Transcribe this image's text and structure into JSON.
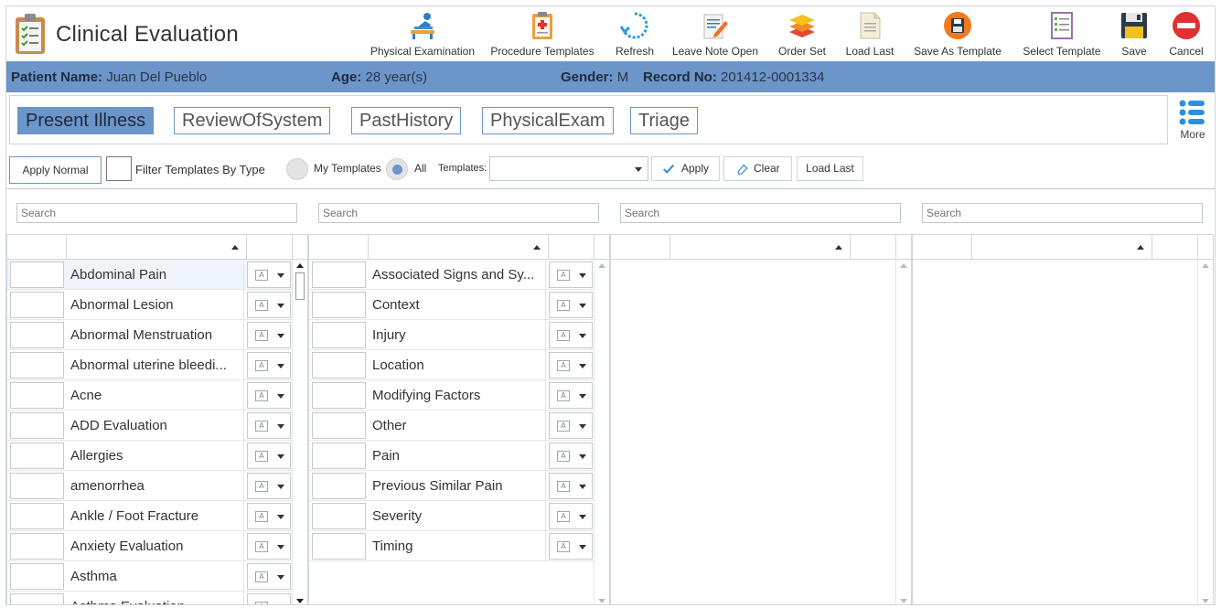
{
  "app": {
    "title": "Clinical Evaluation",
    "logo_icon": "clipboard-checklist-icon"
  },
  "toolbar": [
    {
      "name": "physical-examination",
      "label": "Physical Examination",
      "icon": "examination-table-icon"
    },
    {
      "name": "procedure-templates",
      "label": "Procedure Templates",
      "icon": "clipboard-plus-icon"
    },
    {
      "name": "refresh",
      "label": "Refresh",
      "icon": "refresh-icon"
    },
    {
      "name": "leave-note-open",
      "label": "Leave Note Open",
      "icon": "pen-note-icon"
    },
    {
      "name": "order-set",
      "label": "Order Set",
      "icon": "layers-icon"
    },
    {
      "name": "load-last",
      "label": "Load Last",
      "icon": "document-icon"
    },
    {
      "name": "save-as-template",
      "label": "Save As Template",
      "icon": "floppy-circle-icon"
    },
    {
      "name": "select-template",
      "label": "Select Template",
      "icon": "list-document-icon"
    },
    {
      "name": "save",
      "label": "Save",
      "icon": "floppy-icon"
    },
    {
      "name": "cancel",
      "label": "Cancel",
      "icon": "no-entry-icon"
    }
  ],
  "patient": {
    "name_label": "Patient Name:",
    "name": "Juan Del Pueblo",
    "age_label": "Age:",
    "age": "28 year(s)",
    "gender_label": "Gender:",
    "gender": "M",
    "record_label": "Record No:",
    "record": "201412-0001334"
  },
  "tabs": [
    {
      "label": "Present Illness",
      "active": true
    },
    {
      "label": "ReviewOfSystem",
      "active": false
    },
    {
      "label": "PastHistory",
      "active": false
    },
    {
      "label": "PhysicalExam",
      "active": false
    },
    {
      "label": "Triage",
      "active": false
    }
  ],
  "more_label": "More",
  "filter": {
    "apply_normal": "Apply Normal",
    "filter_by_type": "Filter Templates By Type",
    "my_templates": "My Templates",
    "all": "All",
    "all_selected": true,
    "templates_label": "Templates:",
    "templates_value": "",
    "apply": "Apply",
    "clear": "Clear",
    "load_last": "Load Last"
  },
  "search_placeholder": "Search",
  "panels": [
    {
      "items": [
        "Abdominal Pain",
        "Abnormal Lesion",
        "Abnormal Menstruation",
        "Abnormal uterine bleedi...",
        "Acne",
        "ADD Evaluation",
        "Allergies",
        "amenorrhea",
        "Ankle / Foot Fracture",
        "Anxiety Evaluation",
        "Asthma",
        "Asthma Evaluation"
      ],
      "selected_index": 0
    },
    {
      "items": [
        "Associated Signs and Sy...",
        "Context",
        "Injury",
        "Location",
        "Modifying Factors",
        "Other",
        "Pain",
        "Previous Similar Pain",
        "Severity",
        "Timing"
      ],
      "selected_index": -1
    },
    {
      "items": [],
      "selected_index": -1
    },
    {
      "items": [],
      "selected_index": -1
    }
  ],
  "colors": {
    "accent": "#6c95c9",
    "border": "#d0d7de"
  }
}
